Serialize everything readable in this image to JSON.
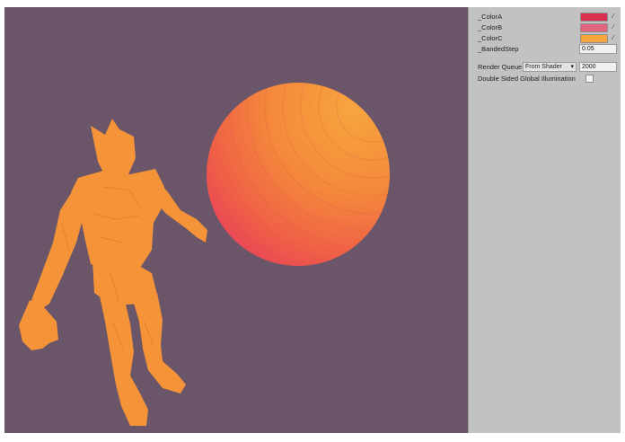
{
  "inspector": {
    "properties": [
      {
        "label": "_ColorA",
        "color": "#d9304f"
      },
      {
        "label": "_ColorB",
        "color": "#e2657f"
      },
      {
        "label": "_ColorC",
        "color": "#f4a63c"
      }
    ],
    "banded_step": {
      "label": "_BandedStep",
      "value": "0.05"
    },
    "render_queue": {
      "label": "Render Queue",
      "mode": "From Shader",
      "value": "2000"
    },
    "double_sided_gi": {
      "label": "Double Sided Global Illumination",
      "checked": false
    }
  },
  "scene": {
    "background": "#6b5569",
    "sphere_colors": [
      "#f59a3c",
      "#f4713e",
      "#ea4a55"
    ],
    "character_color": "#f59338"
  }
}
